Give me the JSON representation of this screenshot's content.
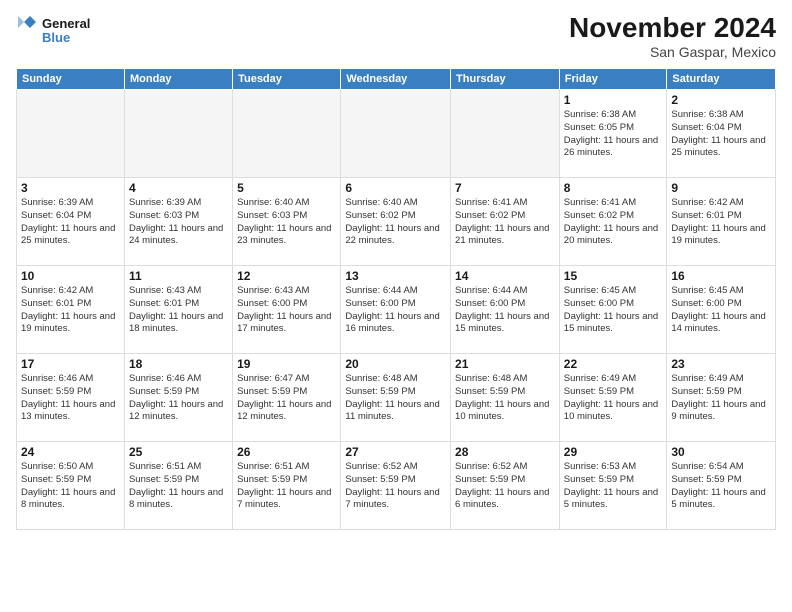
{
  "logo": {
    "line1": "General",
    "line2": "Blue"
  },
  "title": "November 2024",
  "location": "San Gaspar, Mexico",
  "weekdays": [
    "Sunday",
    "Monday",
    "Tuesday",
    "Wednesday",
    "Thursday",
    "Friday",
    "Saturday"
  ],
  "weeks": [
    [
      {
        "day": "",
        "info": ""
      },
      {
        "day": "",
        "info": ""
      },
      {
        "day": "",
        "info": ""
      },
      {
        "day": "",
        "info": ""
      },
      {
        "day": "",
        "info": ""
      },
      {
        "day": "1",
        "info": "Sunrise: 6:38 AM\nSunset: 6:05 PM\nDaylight: 11 hours and 26 minutes."
      },
      {
        "day": "2",
        "info": "Sunrise: 6:38 AM\nSunset: 6:04 PM\nDaylight: 11 hours and 25 minutes."
      }
    ],
    [
      {
        "day": "3",
        "info": "Sunrise: 6:39 AM\nSunset: 6:04 PM\nDaylight: 11 hours and 25 minutes."
      },
      {
        "day": "4",
        "info": "Sunrise: 6:39 AM\nSunset: 6:03 PM\nDaylight: 11 hours and 24 minutes."
      },
      {
        "day": "5",
        "info": "Sunrise: 6:40 AM\nSunset: 6:03 PM\nDaylight: 11 hours and 23 minutes."
      },
      {
        "day": "6",
        "info": "Sunrise: 6:40 AM\nSunset: 6:02 PM\nDaylight: 11 hours and 22 minutes."
      },
      {
        "day": "7",
        "info": "Sunrise: 6:41 AM\nSunset: 6:02 PM\nDaylight: 11 hours and 21 minutes."
      },
      {
        "day": "8",
        "info": "Sunrise: 6:41 AM\nSunset: 6:02 PM\nDaylight: 11 hours and 20 minutes."
      },
      {
        "day": "9",
        "info": "Sunrise: 6:42 AM\nSunset: 6:01 PM\nDaylight: 11 hours and 19 minutes."
      }
    ],
    [
      {
        "day": "10",
        "info": "Sunrise: 6:42 AM\nSunset: 6:01 PM\nDaylight: 11 hours and 19 minutes."
      },
      {
        "day": "11",
        "info": "Sunrise: 6:43 AM\nSunset: 6:01 PM\nDaylight: 11 hours and 18 minutes."
      },
      {
        "day": "12",
        "info": "Sunrise: 6:43 AM\nSunset: 6:00 PM\nDaylight: 11 hours and 17 minutes."
      },
      {
        "day": "13",
        "info": "Sunrise: 6:44 AM\nSunset: 6:00 PM\nDaylight: 11 hours and 16 minutes."
      },
      {
        "day": "14",
        "info": "Sunrise: 6:44 AM\nSunset: 6:00 PM\nDaylight: 11 hours and 15 minutes."
      },
      {
        "day": "15",
        "info": "Sunrise: 6:45 AM\nSunset: 6:00 PM\nDaylight: 11 hours and 15 minutes."
      },
      {
        "day": "16",
        "info": "Sunrise: 6:45 AM\nSunset: 6:00 PM\nDaylight: 11 hours and 14 minutes."
      }
    ],
    [
      {
        "day": "17",
        "info": "Sunrise: 6:46 AM\nSunset: 5:59 PM\nDaylight: 11 hours and 13 minutes."
      },
      {
        "day": "18",
        "info": "Sunrise: 6:46 AM\nSunset: 5:59 PM\nDaylight: 11 hours and 12 minutes."
      },
      {
        "day": "19",
        "info": "Sunrise: 6:47 AM\nSunset: 5:59 PM\nDaylight: 11 hours and 12 minutes."
      },
      {
        "day": "20",
        "info": "Sunrise: 6:48 AM\nSunset: 5:59 PM\nDaylight: 11 hours and 11 minutes."
      },
      {
        "day": "21",
        "info": "Sunrise: 6:48 AM\nSunset: 5:59 PM\nDaylight: 11 hours and 10 minutes."
      },
      {
        "day": "22",
        "info": "Sunrise: 6:49 AM\nSunset: 5:59 PM\nDaylight: 11 hours and 10 minutes."
      },
      {
        "day": "23",
        "info": "Sunrise: 6:49 AM\nSunset: 5:59 PM\nDaylight: 11 hours and 9 minutes."
      }
    ],
    [
      {
        "day": "24",
        "info": "Sunrise: 6:50 AM\nSunset: 5:59 PM\nDaylight: 11 hours and 8 minutes."
      },
      {
        "day": "25",
        "info": "Sunrise: 6:51 AM\nSunset: 5:59 PM\nDaylight: 11 hours and 8 minutes."
      },
      {
        "day": "26",
        "info": "Sunrise: 6:51 AM\nSunset: 5:59 PM\nDaylight: 11 hours and 7 minutes."
      },
      {
        "day": "27",
        "info": "Sunrise: 6:52 AM\nSunset: 5:59 PM\nDaylight: 11 hours and 7 minutes."
      },
      {
        "day": "28",
        "info": "Sunrise: 6:52 AM\nSunset: 5:59 PM\nDaylight: 11 hours and 6 minutes."
      },
      {
        "day": "29",
        "info": "Sunrise: 6:53 AM\nSunset: 5:59 PM\nDaylight: 11 hours and 5 minutes."
      },
      {
        "day": "30",
        "info": "Sunrise: 6:54 AM\nSunset: 5:59 PM\nDaylight: 11 hours and 5 minutes."
      }
    ]
  ]
}
